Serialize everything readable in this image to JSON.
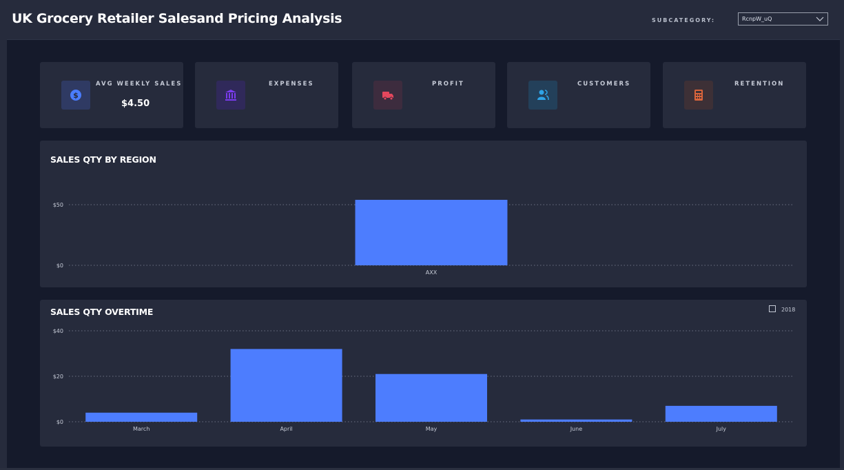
{
  "header": {
    "title": "UK Grocery Retailer Salesand Pricing Analysis",
    "subcategory_label": "SUBCATEGORY:",
    "subcategory_value": "RcnpW_uQ"
  },
  "kpis": [
    {
      "label": "AVG WEEKLY SALES",
      "value": "$4.50",
      "icon": "dollar-coin-icon",
      "color": "#4a7cff"
    },
    {
      "label": "EXPENSES",
      "value": "",
      "icon": "bank-icon",
      "color": "#7b3cf0"
    },
    {
      "label": "PROFIT",
      "value": "",
      "icon": "truck-icon",
      "color": "#e5475d"
    },
    {
      "label": "CUSTOMERS",
      "value": "",
      "icon": "users-icon",
      "color": "#2fa3e6"
    },
    {
      "label": "RETENTION",
      "value": "",
      "icon": "calculator-icon",
      "color": "#d9643b"
    }
  ],
  "colors": {
    "bar": "#4d7dfe",
    "panel": "#262b3c",
    "background": "#151a2b"
  },
  "chart_data": [
    {
      "type": "bar",
      "title": "SALES QTY BY REGION",
      "categories": [
        "AXX"
      ],
      "values": [
        54
      ],
      "ylim": [
        0,
        50
      ],
      "yticks": [
        "$0",
        "$50"
      ],
      "grid": true
    },
    {
      "type": "bar",
      "title": "SALES QTY OVERTIME",
      "categories": [
        "March",
        "April",
        "May",
        "June",
        "July"
      ],
      "values": [
        4,
        32,
        21,
        1,
        7
      ],
      "ylim": [
        0,
        40
      ],
      "yticks": [
        "$0",
        "$20",
        "$40"
      ],
      "grid": true,
      "legend": [
        "2018"
      ],
      "legend_position": "top-right"
    }
  ]
}
